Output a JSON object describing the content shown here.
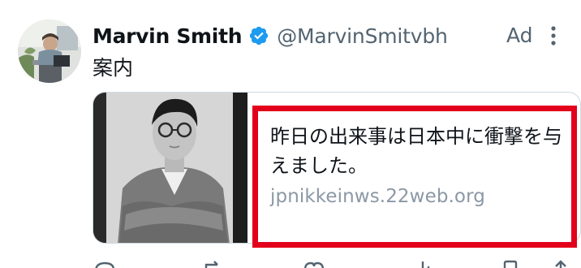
{
  "tweet": {
    "author": {
      "display_name": "Marvin Smith",
      "handle": "@MarvinSmitvbh",
      "verified": true,
      "avatar_icon": "profile-photo"
    },
    "ad_label": "Ad",
    "more_icon": "more-vertical-icon",
    "text": "案内",
    "card": {
      "image_icon": "portrait-photo",
      "title": "昨日の出来事は日本中に衝撃を与えました。",
      "domain": "jpnikkeinws.22web.org"
    },
    "actions": [
      "reply-icon",
      "retweet-icon",
      "like-icon",
      "views-icon",
      "bookmark-icon",
      "share-icon"
    ]
  },
  "colors": {
    "text_primary": "#0f1419",
    "text_secondary": "#536471",
    "domain_text": "#8b98a5",
    "verified_blue": "#1d9bf0",
    "highlight_red": "#e3001b",
    "card_border": "#cfd9de"
  }
}
